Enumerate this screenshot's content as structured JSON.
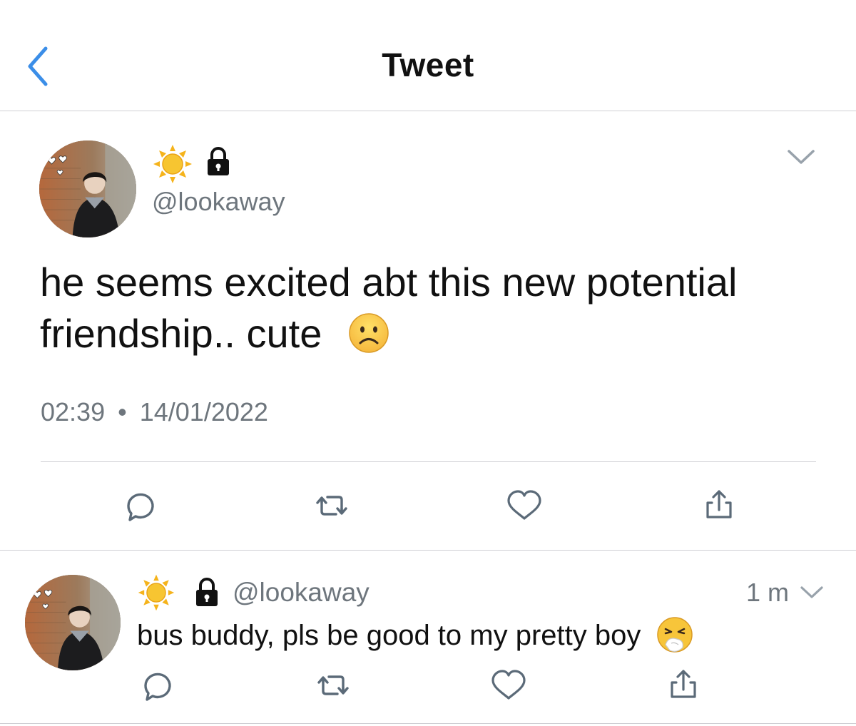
{
  "header": {
    "title": "Tweet"
  },
  "main_tweet": {
    "handle": "@lookaway",
    "name_icons": [
      "sun-emoji",
      "lock-icon"
    ],
    "text_line1": "he seems excited abt this new potential",
    "text_line2": "friendship.. cute",
    "text_emoji": "frowning-face-emoji",
    "time": "02:39",
    "separator": "•",
    "date": "14/01/2022",
    "actions": [
      "reply-icon",
      "retweet-icon",
      "like-icon",
      "share-icon"
    ]
  },
  "reply_tweet": {
    "handle": "@lookaway",
    "name_icons": [
      "sun-emoji",
      "lock-icon"
    ],
    "time_ago": "1 m",
    "text": "bus buddy, pls be good to my pretty boy",
    "text_emoji": "sneezing-face-emoji",
    "actions": [
      "reply-icon",
      "retweet-icon",
      "like-icon",
      "share-icon"
    ]
  },
  "colors": {
    "accent": "#1d9bf0",
    "back_chevron": "#3b8ee8",
    "secondary_text": "#6e767d",
    "divider": "#cfcfd4",
    "icon_stroke": "#5b6a78"
  }
}
